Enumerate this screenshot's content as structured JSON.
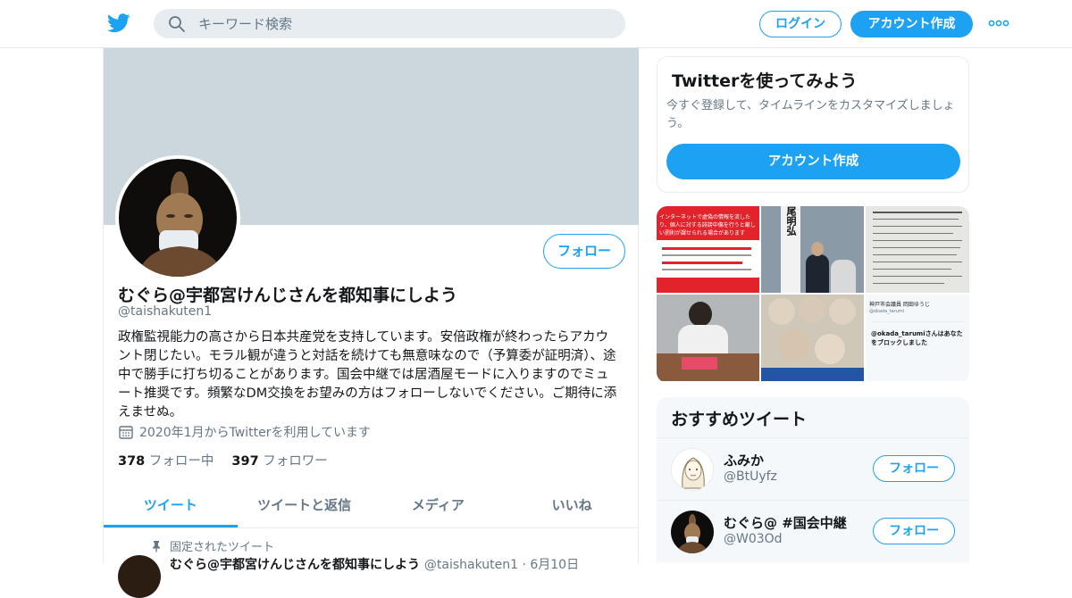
{
  "header": {
    "search_placeholder": "キーワード検索",
    "login_label": "ログイン",
    "signup_label": "アカウント作成"
  },
  "profile": {
    "display_name": "むぐら@宇都宮けんじさんを都知事にしよう",
    "handle": "@taishakuten1",
    "follow_label": "フォロー",
    "bio": "政権監視能力の高さから日本共産党を支持しています。安倍政権が終わったらアカウント閉じたい。モラル観が違うと対話を続けても無意味なので（予算委が証明済）、途中で勝手に打ち切ることがあります。国会中継では居酒屋モードに入りますのでミュート推奨です。頻繁なDM交換をお望みの方はフォローしないでください。ご期待に添えませぬ。",
    "joined": "2020年1月からTwitterを利用しています",
    "following_count": "378",
    "following_label": "フォロー中",
    "followers_count": "397",
    "followers_label": "フォロワー"
  },
  "tabs": [
    {
      "label": "ツイート",
      "active": true
    },
    {
      "label": "ツイートと返信",
      "active": false
    },
    {
      "label": "メディア",
      "active": false
    },
    {
      "label": "いいね",
      "active": false
    }
  ],
  "pinned": {
    "label": "固定されたツイート",
    "head_name": "むぐら@宇都宮けんじさんを都知事にしよう",
    "head_meta": "@taishakuten1 · 6月10日"
  },
  "signup_card": {
    "title": "Twitterを使ってみよう",
    "text": "今すぐ登録して、タイムラインをカスタマイズしましょう。",
    "cta": "アカウント作成"
  },
  "media_tiles": {
    "t1_text": "インターネットで虚偽の情報を流したり、個人に対する誹謗中傷を行うと厳しい罰則が課せられる場合があります",
    "t2_text": "尾明弘",
    "t5_line1": "神戸市会議員 岡田ゆうじ",
    "t6_handle": "@okada_tarumi",
    "t6_text": "@okada_tarumiさんはあなたをブロックしました"
  },
  "suggestions": {
    "title": "おすすめツイート",
    "items": [
      {
        "name": "ふみか",
        "handle": "@BtUyfz",
        "follow_label": "フォロー"
      },
      {
        "name": "むぐら@ #国会中継",
        "handle": "@W03Od",
        "follow_label": "フォロー"
      }
    ]
  },
  "colors": {
    "accent": "#1da1f2",
    "banner": "#ccd6dd",
    "muted_text": "#657786"
  }
}
